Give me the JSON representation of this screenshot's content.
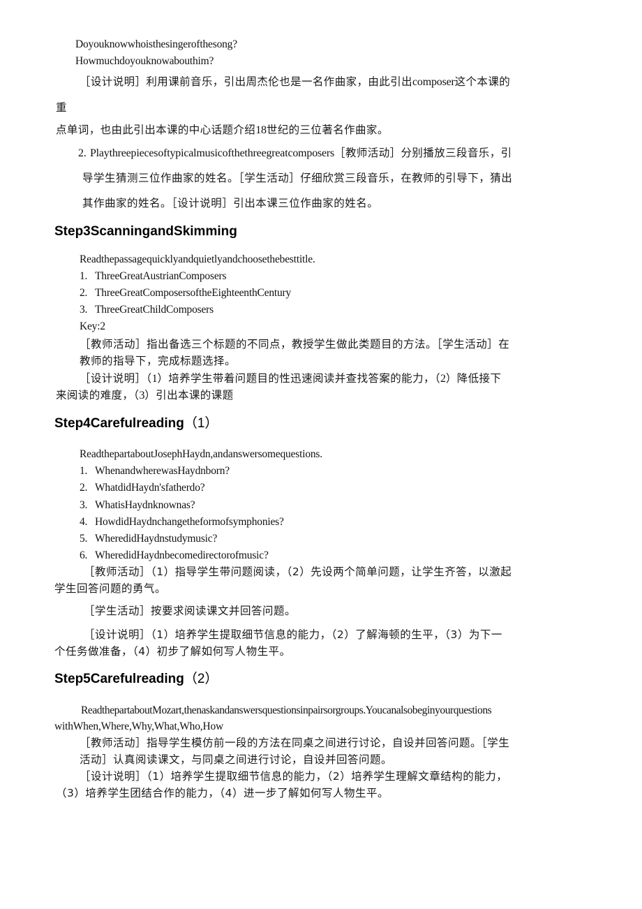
{
  "intro": {
    "q1": "Doyouknowwhoisthesingerofthesong?",
    "q2": "Howmuchdoyouknowabouthim?",
    "design_note_part1": "［设计说明］利用课前音乐，引出周杰伦也是一名作曲家，由此引出",
    "design_note_word": "composer",
    "design_note_part2": "这个本课的",
    "design_note_wrap": "重",
    "design_note_line3_a": "点单词，也由此引出本课的中心话题介绍",
    "design_note_line3_num": "18",
    "design_note_line3_b": "世纪的三位著名作曲家。"
  },
  "activity2": {
    "number": "2.",
    "title": "Playthreepiecesoftypicalmusicofthethreegreatcomposers",
    "line1_rest": "［教师活动］分别播放三段音乐，引",
    "line2": "导学生猜测三位作曲家的姓名。［学生活动］仔细欣赏三段音乐，在教师的引导下，猜出",
    "line3": "其作曲家的姓名。［设计说明］引出本课三位作曲家的姓名。"
  },
  "step3": {
    "heading": "Step3ScanningandSkimming",
    "instruction": "Readthepassagequicklyandquietlyandchoosethebesttitle.",
    "options": [
      {
        "num": "1.",
        "text": "ThreeGreatAustrianComposers"
      },
      {
        "num": "2.",
        "text": "ThreeGreatComposersoftheEighteenthCentury"
      },
      {
        "num": "3.",
        "text": "ThreeGreatChildComposers"
      }
    ],
    "key": "Key:2",
    "teacher_line1": "［教师活动］指出备选三个标题的不同点，教授学生做此类题目的方法。［学生活动］在",
    "teacher_line2": "教师的指导下，完成标题选择。",
    "design_line1_a": "［设计说明］（",
    "design_line1_n1": "1",
    "design_line1_b": "）培养学生带着问题目的性迅速阅读并查找答案的能力，（",
    "design_line1_n2": "2",
    "design_line1_c": "）降低接下",
    "design_line2_a": "来阅读的难度，（",
    "design_line2_n3": "3",
    "design_line2_b": "）引出本课的课题"
  },
  "step4": {
    "heading": "Step4Carefulreading",
    "heading_paren": "（1）",
    "instruction": "ReadthepartaboutJosephHaydn,andanswersomequestions.",
    "questions": [
      {
        "num": "1.",
        "text": "WhenandwherewasHaydnborn?"
      },
      {
        "num": "2.",
        "text": "WhatdidHaydn'sfatherdo?"
      },
      {
        "num": "3.",
        "text": "WhatisHaydnknownas?"
      },
      {
        "num": "4.",
        "text": "HowdidHaydnchangetheformofsymphonies?"
      },
      {
        "num": "5.",
        "text": "WheredidHaydnstudymusic?"
      },
      {
        "num": "6.",
        "text": "WheredidHaydnbecomedirectorofmusic?"
      }
    ],
    "teacher_line1": "［教师活动］（1）指导学生带问题阅读，（2）先设两个简单问题，让学生齐答，以激起",
    "teacher_line2": "学生回答问题的勇气。",
    "student_line": "［学生活动］按要求阅读课文并回答问题。",
    "design_line1": "［设计说明］（1）培养学生提取细节信息的能力，（2）了解海顿的生平，（3）为下一",
    "design_line2": "个任务做准备，（4）初步了解如何写人物生平。"
  },
  "step5": {
    "heading": "Step5Carefulreading",
    "heading_paren": "（2）",
    "instruction_line1": "ReadthepartaboutMozart,thenaskandanswersquestionsinpairsorgroups.Youcanalsobeginyourquestions",
    "instruction_line2": "withWhen,Where,Why,What,Who,How",
    "teacher_line1": "［教师活动］指导学生模仿前一段的方法在同桌之间进行讨论，自设并回答问题。［学生",
    "teacher_line2": "活动］认真阅读课文，与同桌之间进行讨论，自设并回答问题。",
    "design_line1": "［设计说明］（1）培养学生提取细节信息的能力，（2）培养学生理解文章结构的能力，",
    "design_line2": "（3）培养学生团结合作的能力，（4）进一步了解如何写人物生平。"
  }
}
